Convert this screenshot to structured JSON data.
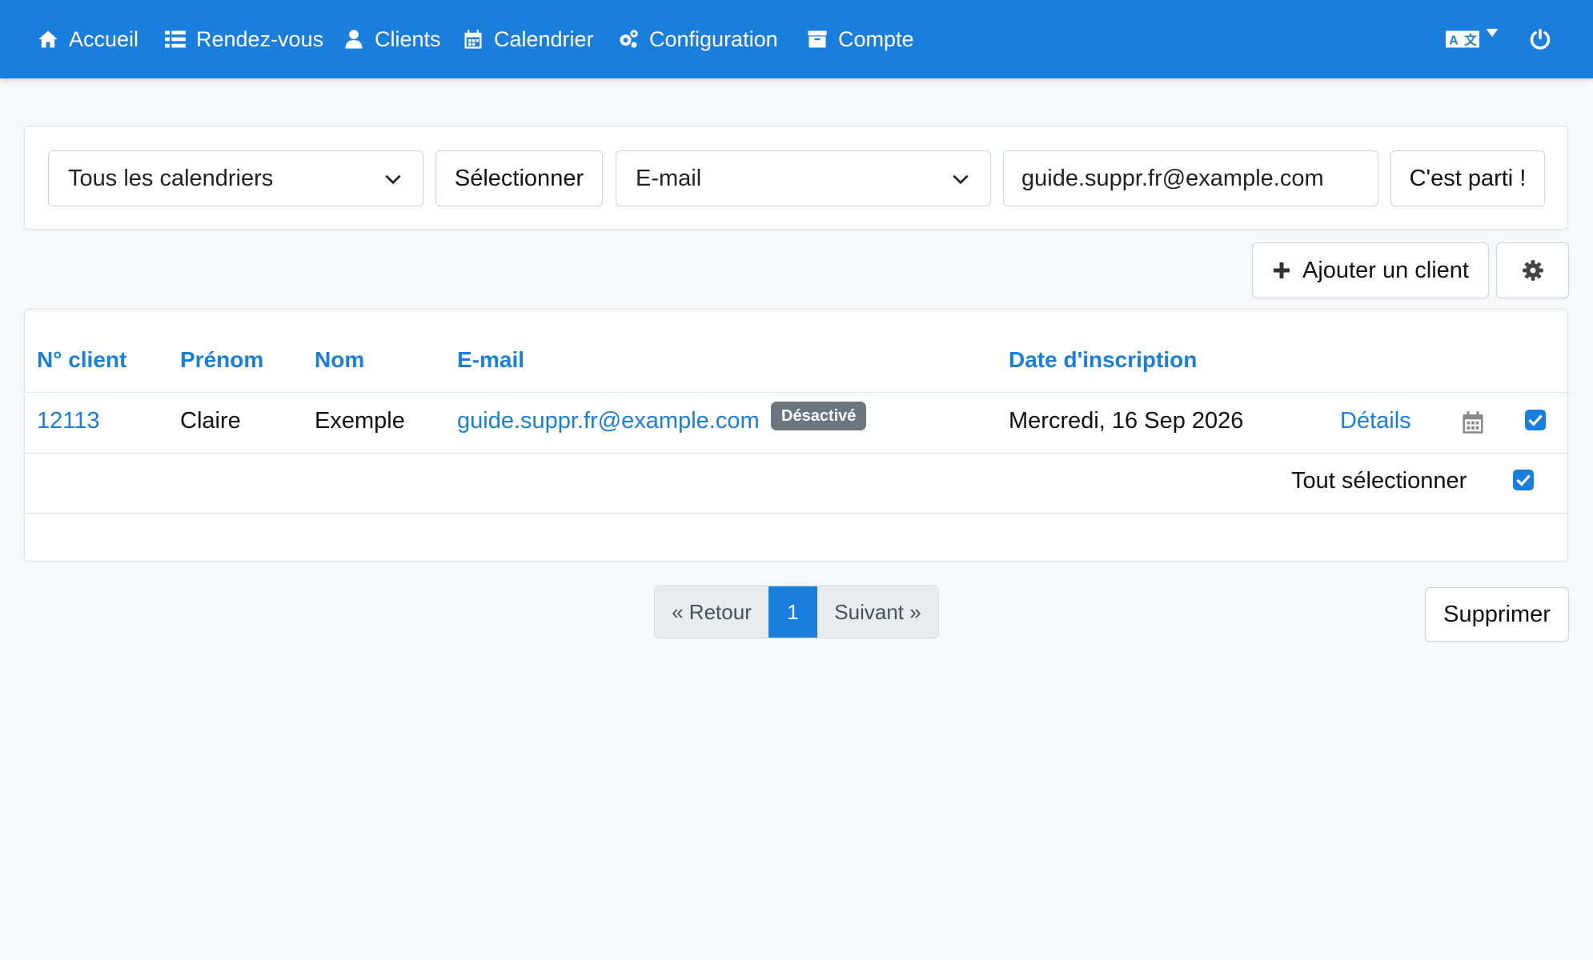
{
  "nav": {
    "items": [
      {
        "label": "Accueil",
        "icon": "home-icon"
      },
      {
        "label": "Rendez-vous",
        "icon": "list-icon"
      },
      {
        "label": "Clients",
        "icon": "user-icon"
      },
      {
        "label": "Calendrier",
        "icon": "calendar-icon"
      },
      {
        "label": "Configuration",
        "icon": "cogs-icon"
      },
      {
        "label": "Compte",
        "icon": "archive-icon"
      }
    ],
    "right": {
      "language_icon": "language-icon",
      "power_icon": "power-icon"
    }
  },
  "filters": {
    "calendar_select": "Tous les calendriers",
    "select_button": "Sélectionner",
    "field_select": "E-mail",
    "search_value": "guide.suppr.fr@example.com",
    "go_button": "C'est parti !"
  },
  "actions": {
    "add_client": "Ajouter un client",
    "settings_icon": "gear-icon"
  },
  "table": {
    "headers": [
      "N° client",
      "Prénom",
      "Nom",
      "E-mail",
      "Date d'inscription"
    ],
    "rows": [
      {
        "id": "12113",
        "first_name": "Claire",
        "last_name": "Exemple",
        "email": "guide.suppr.fr@example.com",
        "status_badge": "Désactivé",
        "registered": "Mercredi, 16 Sep 2026",
        "details_link": "Détails",
        "checked": true
      }
    ],
    "select_all_label": "Tout sélectionner"
  },
  "pagination": {
    "prev": "« Retour",
    "current": "1",
    "next": "Suivant »"
  },
  "delete_button": "Supprimer",
  "colors": {
    "primary": "#1a7fdc",
    "badge": "#6c757d",
    "background": "#f6f8fb"
  }
}
